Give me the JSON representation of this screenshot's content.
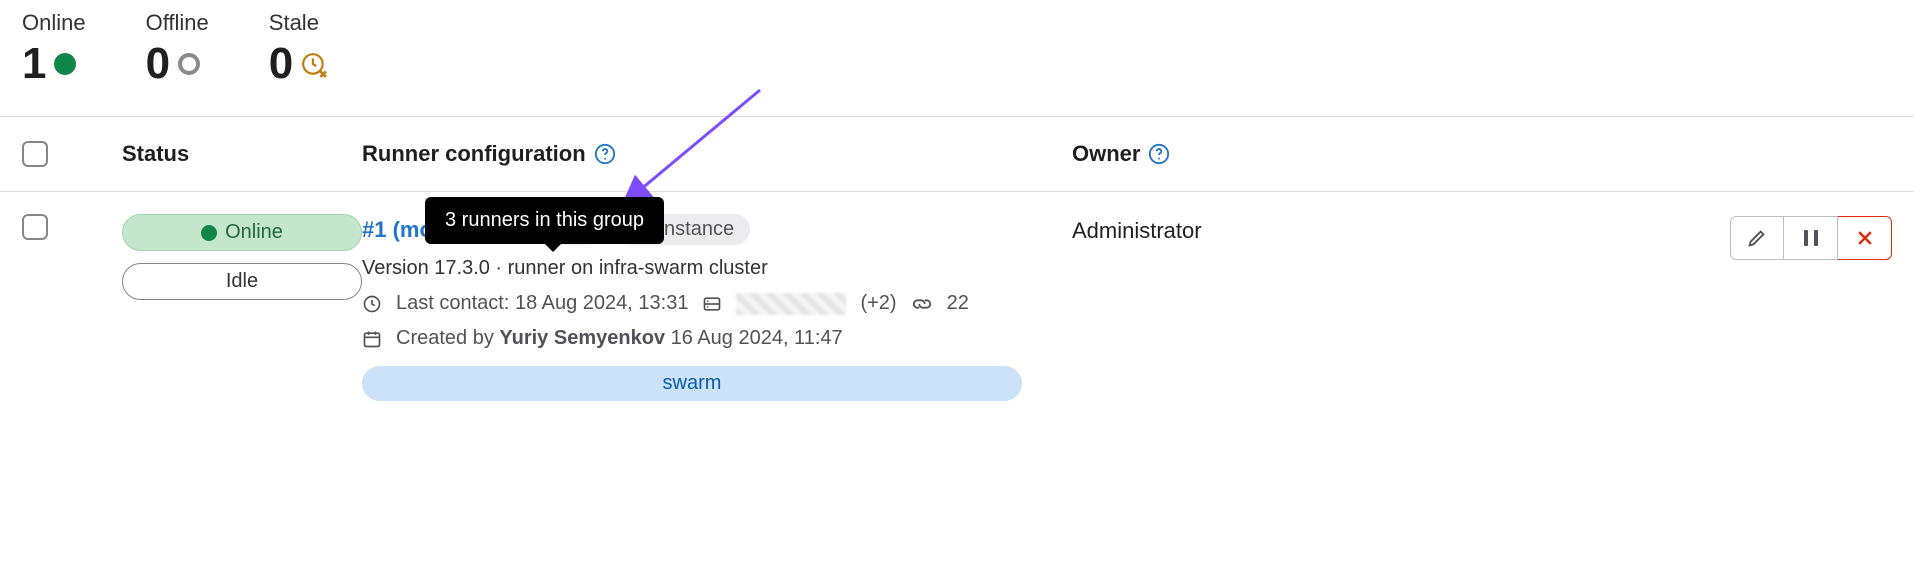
{
  "stats": {
    "online": {
      "label": "Online",
      "value": "1"
    },
    "offline": {
      "label": "Offline",
      "value": "0"
    },
    "stale": {
      "label": "Stale",
      "value": "0"
    }
  },
  "columns": {
    "status": "Status",
    "config": "Runner configuration",
    "owner": "Owner"
  },
  "tooltip": "3 runners in this group",
  "runner": {
    "id_label": "#1 (mona1dpix)",
    "group_count": "3",
    "scope": "Instance",
    "status_online": "Online",
    "status_idle": "Idle",
    "description": "Version 17.3.0 · runner on infra-swarm cluster",
    "last_contact_label": "Last contact: ",
    "last_contact_value": "18 Aug 2024, 13:31",
    "ip_plus": "(+2)",
    "jobs_count": "22",
    "created_prefix": "Created by ",
    "created_author": "Yuriy Semyenkov",
    "created_date": " 16 Aug 2024, 11:47",
    "tag": "swarm"
  },
  "owner": "Administrator"
}
